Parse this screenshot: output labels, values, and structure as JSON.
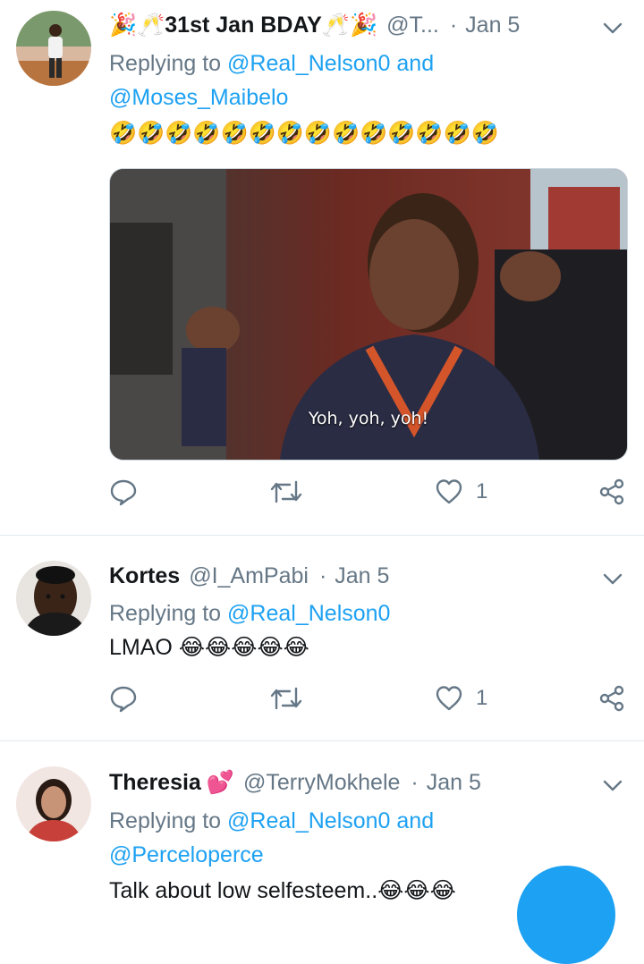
{
  "tweets": [
    {
      "name": "31st Jan BDAY",
      "handle": "@T...",
      "date": "Jan 5",
      "replying_prefix": "Replying to",
      "replying_line1": "@Real_Nelson0 and",
      "replying_line2": "@Moses_Maibelo",
      "emoji_text": "🤣🤣🤣🤣🤣🤣🤣🤣🤣🤣🤣🤣🤣🤣",
      "media_caption": "Yoh, yoh, yoh!",
      "like_count": "1"
    },
    {
      "name": "Kortes",
      "handle": "@I_AmPabi",
      "date": "Jan 5",
      "replying_prefix": "Replying to",
      "replying_line1": "@Real_Nelson0",
      "text": "LMAO",
      "emoji_text": "😂😂😂😂😂",
      "like_count": "1"
    },
    {
      "name": "Theresia",
      "handle": "@TerryMokhele",
      "date": "Jan 5",
      "replying_prefix": "Replying to",
      "replying_line1": "@Real_Nelson0 and",
      "replying_line2": "@Perceloperce",
      "text": "Talk about low selfesteem..",
      "emoji_text": "😂😂😂"
    }
  ],
  "colors": {
    "accent": "#1da1f2",
    "secondary_text": "#657786",
    "primary_text": "#14171a",
    "divider": "#e1e8ed"
  },
  "icons": [
    "chevron-down-icon",
    "reply-icon",
    "retweet-icon",
    "like-icon",
    "share-icon",
    "party-popper-icon",
    "champagne-icon",
    "hearts-icon"
  ]
}
